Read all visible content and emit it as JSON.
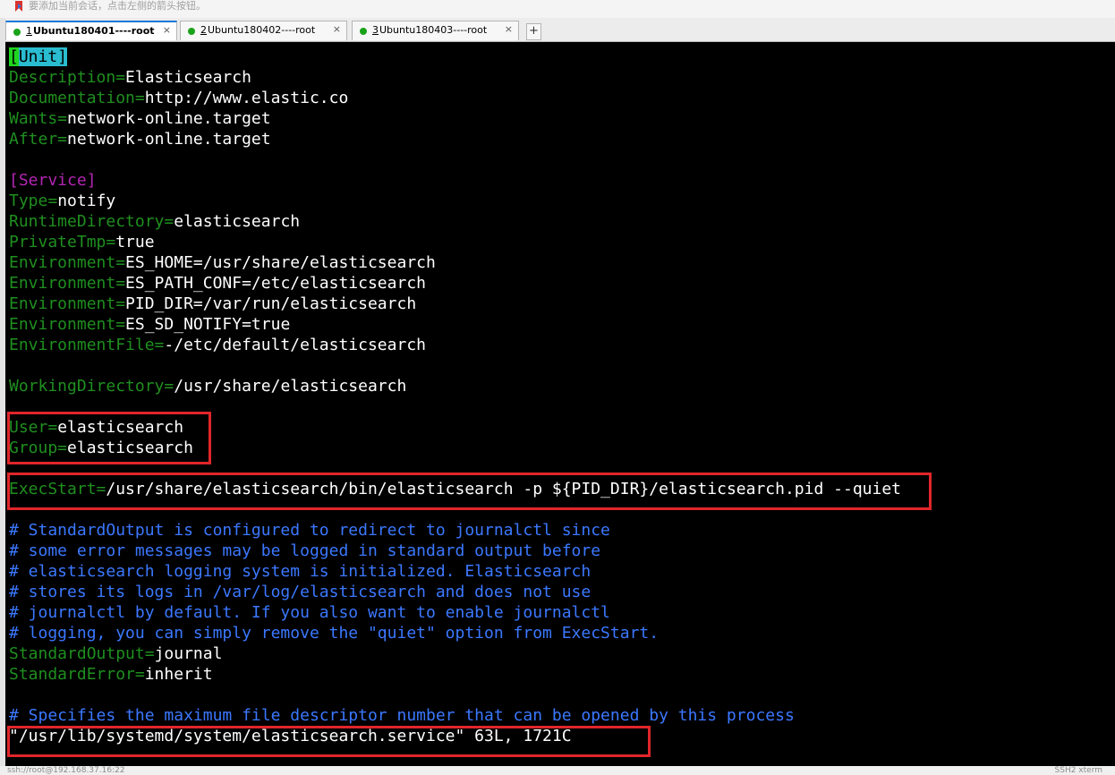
{
  "tip": {
    "text": "要添加当前会话，点击左侧的箭头按钮。",
    "icon": "bookmark-arrow-icon"
  },
  "tabs": [
    {
      "num": "1",
      "name": " Ubuntu180401----root",
      "close": "×"
    },
    {
      "num": "2",
      "name": " Ubuntu180402----root",
      "close": "×"
    },
    {
      "num": "3",
      "name": " Ubuntu180403----root",
      "close": "×"
    }
  ],
  "tab_add": "+",
  "terminal": {
    "unit_header": {
      "cursor": "[",
      "name": "Unit",
      "close": "]"
    },
    "lines": [
      {
        "key": "Description=",
        "value": "Elasticsearch"
      },
      {
        "key": "Documentation=",
        "value": "http://www.elastic.co"
      },
      {
        "key": "Wants=",
        "value": "network-online.target"
      },
      {
        "key": "After=",
        "value": "network-online.target"
      },
      {
        "section": "[Service]"
      },
      {
        "key": "Type=",
        "value": "notify"
      },
      {
        "key": "RuntimeDirectory=",
        "value": "elasticsearch"
      },
      {
        "key": "PrivateTmp=",
        "value": "true"
      },
      {
        "key": "Environment=",
        "value": "ES_HOME=/usr/share/elasticsearch"
      },
      {
        "key": "Environment=",
        "value": "ES_PATH_CONF=/etc/elasticsearch"
      },
      {
        "key": "Environment=",
        "value": "PID_DIR=/var/run/elasticsearch"
      },
      {
        "key": "Environment=",
        "value": "ES_SD_NOTIFY=true"
      },
      {
        "key": "EnvironmentFile=",
        "value": "-/etc/default/elasticsearch"
      },
      {
        "key": "WorkingDirectory=",
        "value": "/usr/share/elasticsearch"
      },
      {
        "key": "User=",
        "value": "elasticsearch"
      },
      {
        "key": "Group=",
        "value": "elasticsearch"
      },
      {
        "key": "ExecStart=",
        "value": "/usr/share/elasticsearch/bin/elasticsearch -p ${PID_DIR}/elasticsearch.pid --quiet"
      },
      {
        "comment": "# StandardOutput is configured to redirect to journalctl since"
      },
      {
        "comment": "# some error messages may be logged in standard output before"
      },
      {
        "comment": "# elasticsearch logging system is initialized. Elasticsearch"
      },
      {
        "comment": "# stores its logs in /var/log/elasticsearch and does not use"
      },
      {
        "comment": "# journalctl by default. If you also want to enable journalctl"
      },
      {
        "comment": "# logging, you can simply remove the \"quiet\" option from ExecStart."
      },
      {
        "key": "StandardOutput=",
        "value": "journal"
      },
      {
        "key": "StandardError=",
        "value": "inherit"
      },
      {
        "comment": "# Specifies the maximum file descriptor number that can be opened by this process"
      }
    ],
    "vim_status": "\"/usr/lib/systemd/system/elasticsearch.service\" 63L, 1721C"
  },
  "status_bar": {
    "left": "ssh://root@192.168.37.16:22",
    "right": "SSH2   xterm"
  },
  "colors": {
    "key": "#1f8f1f",
    "section": "#b325b3",
    "comment": "#3b78ff",
    "cursor": "#1fd51f",
    "annotation": "#e0262a",
    "active_tab_accent": "#1e78d8"
  }
}
